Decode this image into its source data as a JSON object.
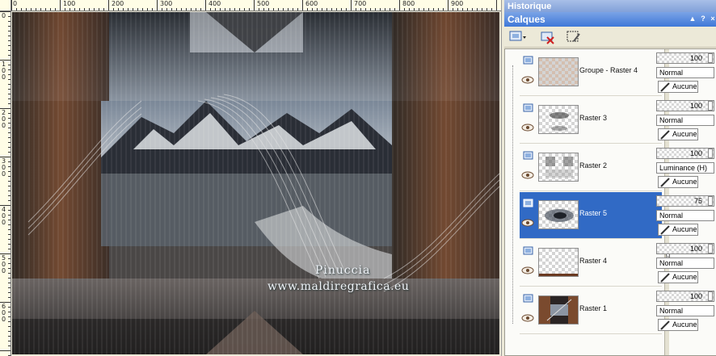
{
  "ruler": {
    "top_labels": [
      "0",
      "100",
      "200",
      "300",
      "400",
      "500",
      "600",
      "700",
      "800",
      "900"
    ],
    "left_labels": [
      "0",
      "1\n0\n0",
      "2\n0\n0",
      "3\n0\n0",
      "4\n0\n0",
      "5\n0\n0",
      "6\n0\n0"
    ]
  },
  "canvas": {
    "watermark_name": "Pinuccia",
    "watermark_url": "www.maldiregrafica.eu"
  },
  "panels": {
    "history_title": "Historique",
    "layers_title": "Calques"
  },
  "layers": [
    {
      "name": "Groupe - Raster 4",
      "opacity": "100",
      "blend": "Normal",
      "mask": "Aucune",
      "selected": false
    },
    {
      "name": "Raster 3",
      "opacity": "100",
      "blend": "Normal",
      "mask": "Aucune",
      "selected": false
    },
    {
      "name": "Raster 2",
      "opacity": "100",
      "blend": "Luminance (H)",
      "mask": "Aucune",
      "selected": false
    },
    {
      "name": "Raster 5",
      "opacity": "75",
      "blend": "Normal",
      "mask": "Aucune",
      "selected": true
    },
    {
      "name": "Raster 4",
      "opacity": "100",
      "blend": "Normal",
      "mask": "Aucune",
      "selected": false
    },
    {
      "name": "Raster 1",
      "opacity": "100",
      "blend": "Normal",
      "mask": "Aucune",
      "selected": false
    }
  ],
  "colors": {
    "selection": "#316ac5",
    "titlebar": "#3f78d8"
  }
}
